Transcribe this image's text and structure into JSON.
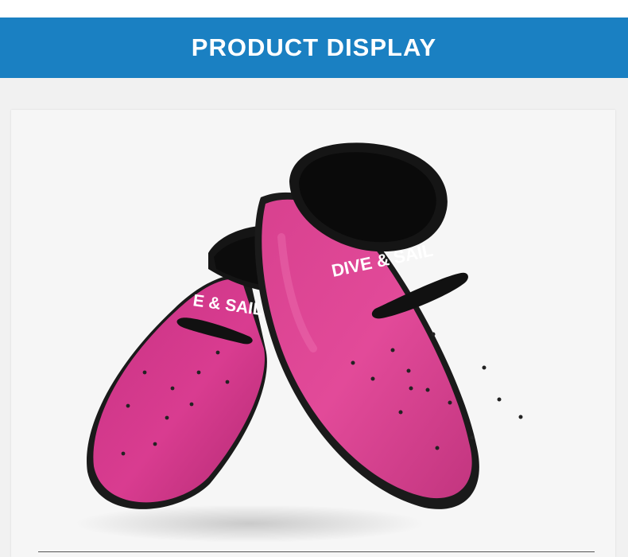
{
  "banner": {
    "title": "PRODUCT DISPLAY",
    "color": "#1a80c2",
    "text_color": "#ffffff"
  },
  "product": {
    "right_shoe_print": "DIVE & SAIL",
    "left_shoe_print": "E & SAIL",
    "shoe_color": "#d63a8f",
    "collar_color": "#151515"
  }
}
